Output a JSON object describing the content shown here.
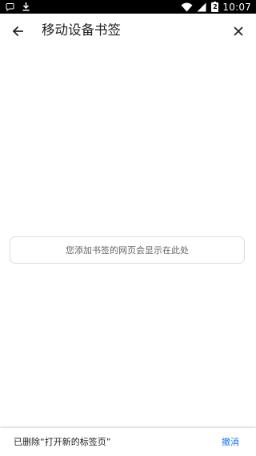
{
  "status_bar": {
    "time": "10:07",
    "battery_level": "2",
    "icons": [
      "message-icon",
      "download-icon",
      "wifi-icon",
      "cellular-signal-icon",
      "battery-icon"
    ]
  },
  "header": {
    "title": "移动设备书签",
    "back_icon": "arrow-back-icon",
    "close_icon": "close-icon"
  },
  "main": {
    "empty_message": "您添加书签的网页会显示在此处"
  },
  "snackbar": {
    "message": "已删除“打开新的标签页”",
    "action_label": "撤消",
    "action_color": "#1a73e8"
  }
}
